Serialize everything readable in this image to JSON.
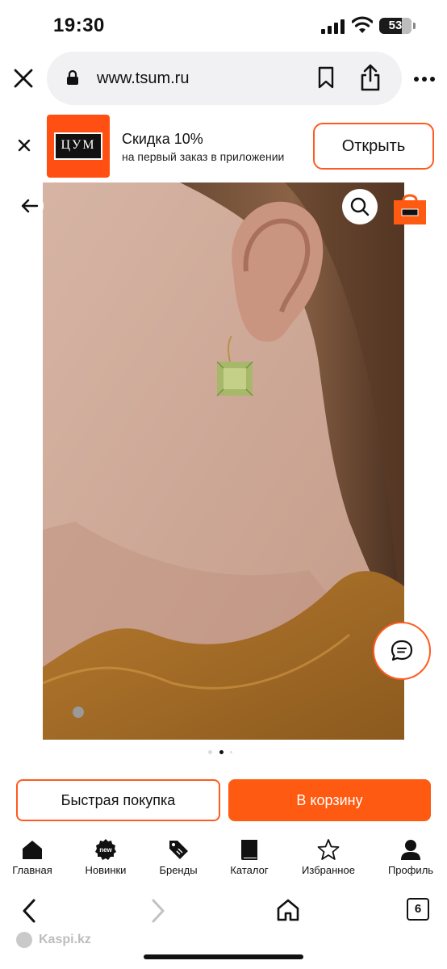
{
  "status_bar": {
    "time": "19:30",
    "battery": "53"
  },
  "browser": {
    "url": "www.tsum.ru"
  },
  "app_banner": {
    "logo_text": "ЦУМ",
    "title": "Скидка 10%",
    "subtitle": "на первый заказ в приложении",
    "open_label": "Открыть"
  },
  "product_gallery": {
    "slide_count": 3,
    "active_slide": 2
  },
  "actions": {
    "quick_buy_label": "Быстрая покупка",
    "add_to_cart_label": "В корзину"
  },
  "tabbar": {
    "items": [
      {
        "label": "Главная",
        "icon": "home-icon"
      },
      {
        "label": "Новинки",
        "icon": "new-badge-icon",
        "badge": "new"
      },
      {
        "label": "Бренды",
        "icon": "tag-icon"
      },
      {
        "label": "Каталог",
        "icon": "book-icon"
      },
      {
        "label": "Избранное",
        "icon": "star-icon"
      },
      {
        "label": "Профиль",
        "icon": "user-icon"
      }
    ]
  },
  "browser_toolbar": {
    "tabs_count": "6"
  },
  "footer": {
    "brand": "Kaspi.kz"
  },
  "colors": {
    "accent": "#ff5a11",
    "logo_bg": "#ff4f12"
  }
}
